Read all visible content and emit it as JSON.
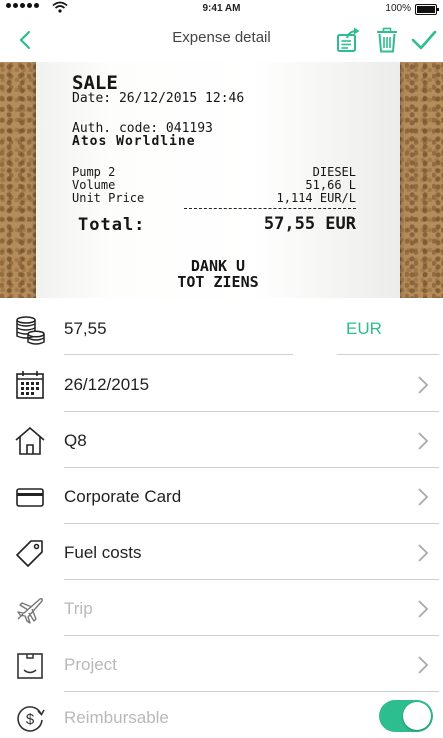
{
  "status_bar": {
    "time": "9:41 AM",
    "battery": "100%"
  },
  "nav": {
    "title": "Expense detail"
  },
  "receipt": {
    "sale": "SALE",
    "date_line": "Date: 26/12/2015 12:46",
    "auth_line": "Auth. code: 041193",
    "provider": "Atos Worldline",
    "rows": [
      {
        "label": "Pump 2",
        "value": "DIESEL"
      },
      {
        "label": "Volume",
        "value": "51,66 L"
      },
      {
        "label": "Unit Price",
        "value": "1,114 EUR/L"
      }
    ],
    "total_label": "Total:",
    "total_value": "57,55 EUR",
    "footer1": "DANK U",
    "footer2": "TOT ZIENS"
  },
  "form": {
    "amount": "57,55",
    "currency": "EUR",
    "date": "26/12/2015",
    "merchant": "Q8",
    "payment": "Corporate Card",
    "category": "Fuel costs",
    "trip_placeholder": "Trip",
    "project_placeholder": "Project",
    "reimbursable_label": "Reimbursable",
    "reimbursable_on": true
  },
  "colors": {
    "accent": "#2dbd8f",
    "muted": "#b9b9b9"
  }
}
